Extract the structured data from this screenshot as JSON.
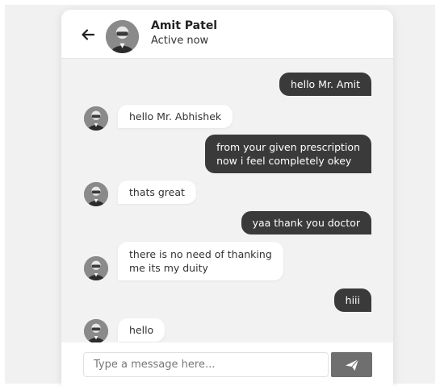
{
  "header": {
    "contact_name": "Amit Patel",
    "contact_status": "Active now",
    "back_icon": "arrow-left-icon"
  },
  "messages": [
    {
      "direction": "sent",
      "text": "hello Mr. Amit"
    },
    {
      "direction": "received",
      "text": "hello Mr. Abhishek"
    },
    {
      "direction": "sent",
      "lines": [
        "from your given prescription",
        "now i feel completely okey"
      ]
    },
    {
      "direction": "received",
      "text": "thats great"
    },
    {
      "direction": "sent",
      "text": "yaa thank you doctor"
    },
    {
      "direction": "received",
      "lines": [
        "there is no need of thanking",
        "me its my duity"
      ]
    },
    {
      "direction": "sent",
      "text": "hiii"
    },
    {
      "direction": "received",
      "text": "hello"
    }
  ],
  "composer": {
    "placeholder": "Type a message here...",
    "send_icon": "send-icon"
  },
  "colors": {
    "sent_bubble": "#3a3a3a",
    "received_bubble": "#ffffff",
    "send_button": "#6f6f6f",
    "chat_background": "#f2f2f2"
  }
}
